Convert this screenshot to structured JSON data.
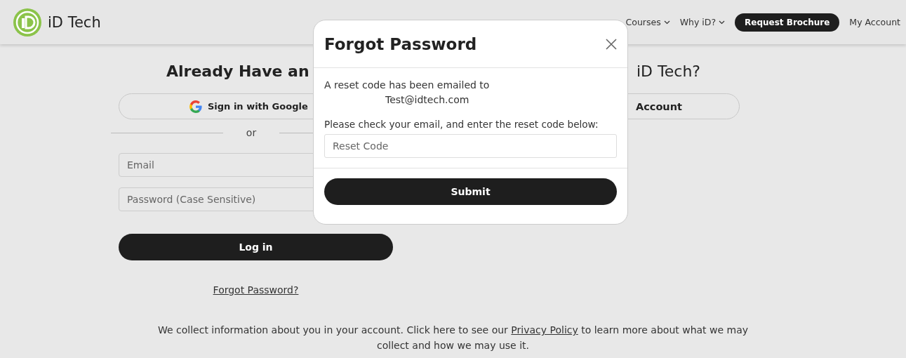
{
  "header": {
    "logo_text": "iD Tech",
    "nav": [
      {
        "label": "Courses",
        "kind": "dropdown"
      },
      {
        "label": "Why iD?",
        "kind": "dropdown"
      },
      {
        "label": "Request Brochure",
        "kind": "cta"
      },
      {
        "label": "My Account",
        "kind": "link"
      }
    ]
  },
  "login": {
    "heading": "Already Have an",
    "google_button": "Sign in with Google",
    "divider": "or",
    "email_placeholder": "Email",
    "password_placeholder": "Password (Case Sensitive)",
    "login_button": "Log in",
    "forgot_link": "Forgot Password?"
  },
  "signup": {
    "heading": "iD Tech?",
    "button": "Account"
  },
  "privacy": {
    "before": "We collect information about you in your account. Click here to see our",
    "link": "Privacy Policy",
    "after": "to learn more about what we may collect and how we may use it."
  },
  "modal": {
    "title": "Forgot Password",
    "message": "A reset code has been emailed to",
    "email": "Test@idtech.com",
    "instruction": "Please check your email, and enter the reset code below:",
    "code_placeholder": "Reset Code",
    "submit": "Submit"
  }
}
